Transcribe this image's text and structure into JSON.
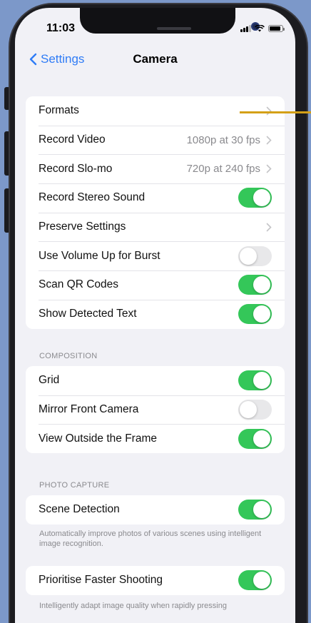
{
  "status_bar": {
    "time": "11:03"
  },
  "nav": {
    "back_label": "Settings",
    "title": "Camera"
  },
  "groups": {
    "main": [
      {
        "label": "Formats",
        "value": "",
        "control": "chevron"
      },
      {
        "label": "Record Video",
        "value": "1080p at 30 fps",
        "control": "chevron"
      },
      {
        "label": "Record Slo-mo",
        "value": "720p at 240 fps",
        "control": "chevron"
      },
      {
        "label": "Record Stereo Sound",
        "control": "toggle",
        "on": true
      },
      {
        "label": "Preserve Settings",
        "value": "",
        "control": "chevron"
      },
      {
        "label": "Use Volume Up for Burst",
        "control": "toggle",
        "on": false
      },
      {
        "label": "Scan QR Codes",
        "control": "toggle",
        "on": true
      },
      {
        "label": "Show Detected Text",
        "control": "toggle",
        "on": true
      }
    ],
    "composition_header": "COMPOSITION",
    "composition": [
      {
        "label": "Grid",
        "control": "toggle",
        "on": true
      },
      {
        "label": "Mirror Front Camera",
        "control": "toggle",
        "on": false
      },
      {
        "label": "View Outside the Frame",
        "control": "toggle",
        "on": true
      }
    ],
    "photo_capture_header": "PHOTO CAPTURE",
    "photo_capture": [
      {
        "label": "Scene Detection",
        "control": "toggle",
        "on": true
      }
    ],
    "scene_detection_footer": "Automatically improve photos of various scenes using intelligent image recognition.",
    "faster_shooting": [
      {
        "label": "Prioritise Faster Shooting",
        "control": "toggle",
        "on": true
      }
    ],
    "faster_shooting_footer": "Intelligently adapt image quality when rapidly pressing"
  },
  "colors": {
    "accent": "#2f7cf6",
    "toggle_on": "#34c759",
    "toggle_off": "#e8e8ea",
    "annotation": "#d4a017",
    "background": "#7c98c9"
  }
}
